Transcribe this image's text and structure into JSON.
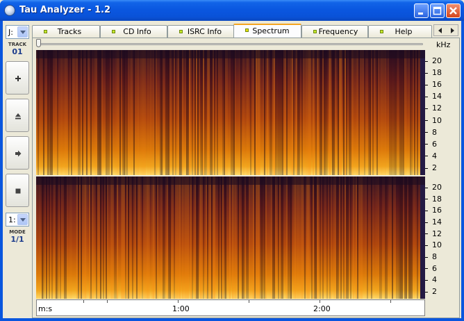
{
  "window": {
    "title": "Tau Analyzer - 1.2"
  },
  "title_buttons": {
    "minimize": "minimize-icon",
    "maximize": "maximize-icon",
    "close": "close-icon"
  },
  "sidebar": {
    "drive_value": "J:",
    "track_label": "TRACK",
    "track_value": "01",
    "buttons": [
      "plus-icon",
      "eject-icon",
      "play-icon",
      "stop-icon"
    ],
    "mode_select_value": "1:",
    "mode_label": "MODE",
    "mode_value": "1/1"
  },
  "tabs": [
    {
      "label": "Tracks"
    },
    {
      "label": "CD Info"
    },
    {
      "label": "ISRC Info"
    },
    {
      "label": "Spectrum",
      "active": true
    },
    {
      "label": "Frequency"
    },
    {
      "label": "Help"
    }
  ],
  "tab_scroll": {
    "left": "scroll-left-icon",
    "right": "scroll-right-icon"
  },
  "spectrum": {
    "unit_label": "kHz",
    "freq_ticks": [
      "20",
      "18",
      "16",
      "14",
      "12",
      "10",
      "8",
      "6",
      "4",
      "2"
    ],
    "time_axis": {
      "unit_label": "m:s",
      "labels": [
        "1:00",
        "2:00"
      ]
    }
  },
  "colors": {
    "titlebar": "#0a56de",
    "spectrum_bright": "#ffd040",
    "spectrum_dark": "#2a0f1e",
    "tab_active": "#f4a420"
  }
}
